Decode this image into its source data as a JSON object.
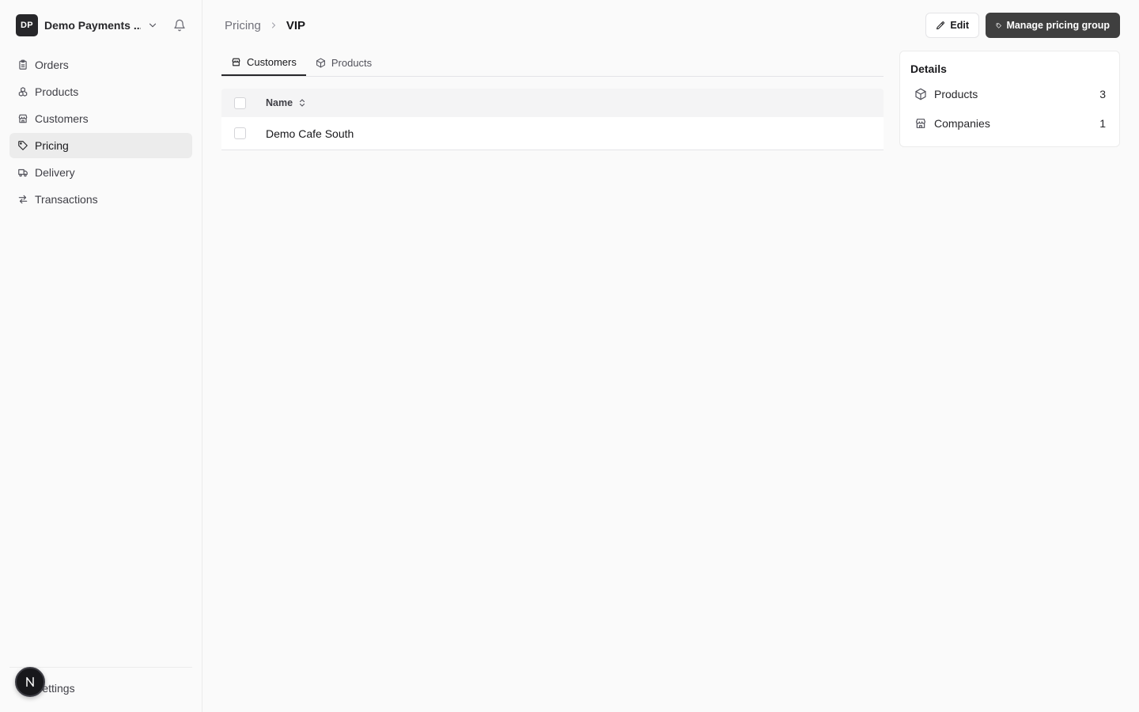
{
  "org": {
    "initials": "DP",
    "name": "Demo Payments ..."
  },
  "sidebar": {
    "items": [
      {
        "label": "Orders",
        "icon": "clipboard-icon",
        "active": false
      },
      {
        "label": "Products",
        "icon": "boxes-icon",
        "active": false
      },
      {
        "label": "Customers",
        "icon": "store-icon",
        "active": false
      },
      {
        "label": "Pricing",
        "icon": "tag-icon",
        "active": true
      },
      {
        "label": "Delivery",
        "icon": "truck-icon",
        "active": false
      },
      {
        "label": "Transactions",
        "icon": "arrows-icon",
        "active": false
      }
    ],
    "settings_label": "Settings"
  },
  "fab": {
    "letter": "N"
  },
  "breadcrumb": {
    "parent": "Pricing",
    "current": "VIP"
  },
  "toolbar": {
    "edit_label": "Edit",
    "manage_label": "Manage pricing group"
  },
  "tabs": [
    {
      "label": "Customers",
      "icon": "store-icon",
      "active": true
    },
    {
      "label": "Products",
      "icon": "package-icon",
      "active": false
    }
  ],
  "table": {
    "columns": [
      "Name"
    ],
    "rows": [
      {
        "name": "Demo Cafe South"
      }
    ]
  },
  "details": {
    "title": "Details",
    "rows": [
      {
        "label": "Products",
        "icon": "package-icon",
        "count": "3"
      },
      {
        "label": "Companies",
        "icon": "store-icon",
        "count": "1"
      }
    ]
  },
  "colors": {
    "accent": "#3f3f3f",
    "active_bg": "#ececec",
    "background": "#fafafa"
  }
}
